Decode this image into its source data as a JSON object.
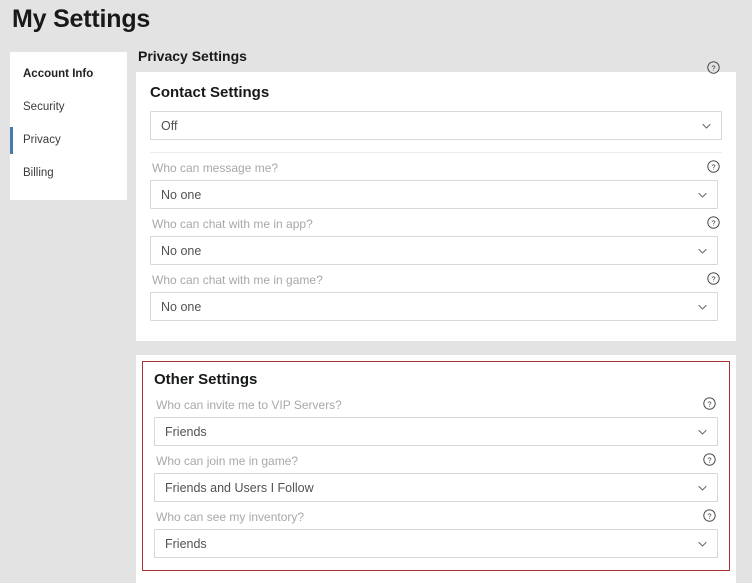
{
  "page": {
    "title": "My Settings"
  },
  "sidebar": {
    "items": [
      {
        "label": "Account Info",
        "active": false,
        "bold": true
      },
      {
        "label": "Security",
        "active": false,
        "bold": false
      },
      {
        "label": "Privacy",
        "active": true,
        "bold": false
      },
      {
        "label": "Billing",
        "active": false,
        "bold": false
      }
    ]
  },
  "main": {
    "section_title": "Privacy Settings",
    "contact_settings": {
      "heading": "Contact Settings",
      "master_value": "Off",
      "fields": [
        {
          "label": "Who can message me?",
          "value": "No one"
        },
        {
          "label": "Who can chat with me in app?",
          "value": "No one"
        },
        {
          "label": "Who can chat with me in game?",
          "value": "No one"
        }
      ]
    },
    "other_settings": {
      "heading": "Other Settings",
      "border_color": "#a83232",
      "fields": [
        {
          "label": "Who can invite me to VIP Servers?",
          "value": "Friends"
        },
        {
          "label": "Who can join me in game?",
          "value": "Friends and Users I Follow"
        },
        {
          "label": "Who can see my inventory?",
          "value": "Friends"
        }
      ]
    }
  },
  "icons": {
    "help": "help-circle-icon",
    "chevron": "chevron-down-icon"
  },
  "colors": {
    "page_background": "#e3e3e3",
    "card_background": "#ffffff",
    "active_accent": "#4a7ba6",
    "outline_accent": "#a83232",
    "label_text": "#a8a8a8",
    "value_text": "#4f5254"
  }
}
